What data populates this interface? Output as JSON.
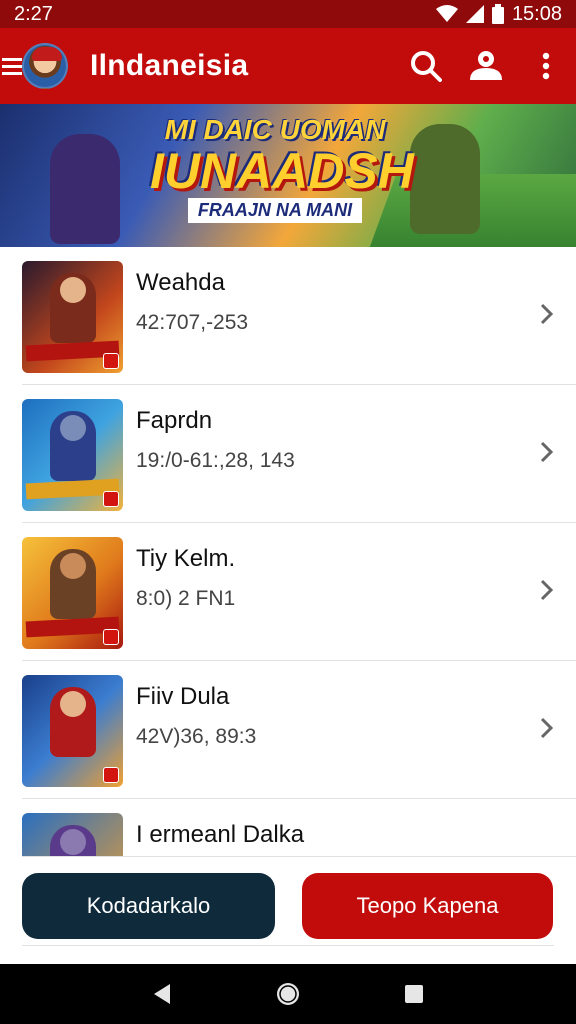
{
  "status_bar": {
    "time": "2:27",
    "clock": "15:08"
  },
  "app_bar": {
    "title": "Ilndaneisia"
  },
  "banner": {
    "line1": "MI DAIC UOMAN",
    "line2": "IUNAADSH",
    "line3": "FRAAJN NA MANI"
  },
  "items": [
    {
      "title": "Weahda",
      "subtitle": "42:707,-253"
    },
    {
      "title": "Faprdn",
      "subtitle": "19:/0-61:,28, 143"
    },
    {
      "title": "Tiy Kelm.",
      "subtitle": "8:0) 2 FN1"
    },
    {
      "title": "Fiiv Dula",
      "subtitle": "42V)36, 89:3"
    },
    {
      "title": "I ermeanl Dalka"
    }
  ],
  "actions": {
    "primary": "Kodadarkalo",
    "secondary": "Teopo Kapena"
  },
  "colors": {
    "primary_red": "#c20c0c",
    "dark_button": "#0e2a3b",
    "status_bar": "#8f0a0a"
  }
}
